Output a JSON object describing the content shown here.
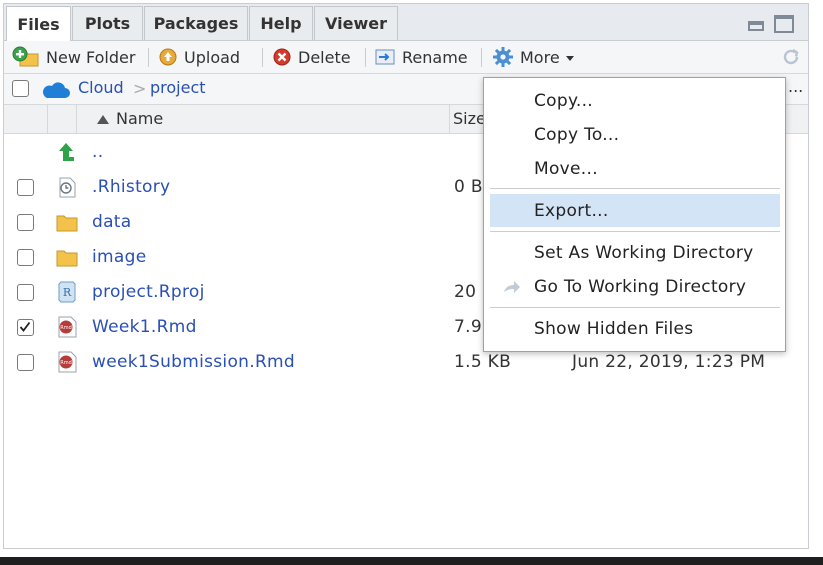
{
  "tabs": [
    {
      "label": "Files",
      "active": true
    },
    {
      "label": "Plots",
      "active": false
    },
    {
      "label": "Packages",
      "active": false
    },
    {
      "label": "Help",
      "active": false
    },
    {
      "label": "Viewer",
      "active": false
    }
  ],
  "toolbar": {
    "new_folder": "New Folder",
    "upload": "Upload",
    "delete": "Delete",
    "rename": "Rename",
    "more": "More"
  },
  "path": {
    "cloud": "Cloud",
    "separator": ">",
    "project": "project",
    "overflow": "..."
  },
  "columns": {
    "name": "Name",
    "size_partial": "Size"
  },
  "files": [
    {
      "name": "..",
      "size": "",
      "modified": "",
      "checked": false,
      "icon": "up-arrow-icon"
    },
    {
      "name": ".Rhistory",
      "size": "0 B",
      "modified": "",
      "checked": false,
      "icon": "history-file-icon"
    },
    {
      "name": "data",
      "size": "",
      "modified": "",
      "checked": false,
      "icon": "folder-icon"
    },
    {
      "name": "image",
      "size": "",
      "modified": "",
      "checked": false,
      "icon": "folder-icon"
    },
    {
      "name": "project.Rproj",
      "size": "20",
      "modified": "",
      "checked": false,
      "icon": "rproj-file-icon"
    },
    {
      "name": "Week1.Rmd",
      "size": "7.9",
      "modified": "",
      "checked": true,
      "icon": "rmd-file-icon"
    },
    {
      "name": "week1Submission.Rmd",
      "size": "1.5 KB",
      "modified": "Jun 22, 2019, 1:23 PM",
      "checked": false,
      "icon": "rmd-file-icon"
    }
  ],
  "menu": {
    "copy": "Copy...",
    "copy_to": "Copy To...",
    "move": "Move...",
    "export": "Export...",
    "set_wd": "Set As Working Directory",
    "goto_wd": "Go To Working Directory",
    "show_hidden": "Show Hidden Files"
  },
  "colors": {
    "link": "#2a4fb5",
    "menu_highlight": "#d2e4f5",
    "folder": "#f2c24a"
  }
}
